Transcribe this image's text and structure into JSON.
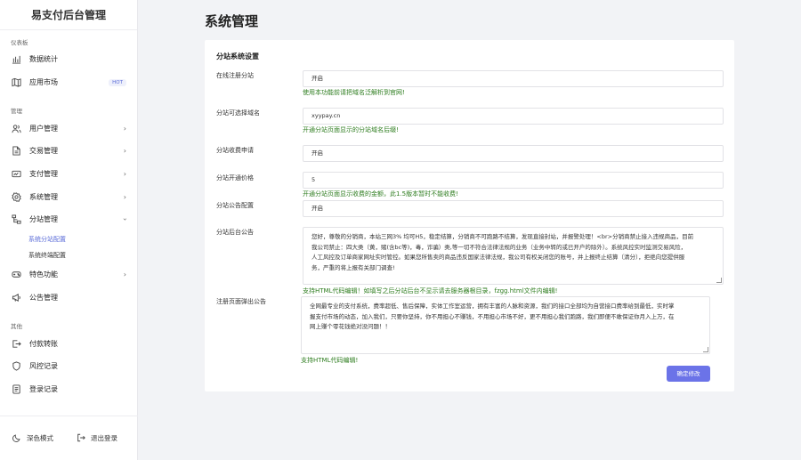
{
  "app": {
    "title": "易支付后台管理"
  },
  "sidebar": {
    "sections": {
      "dashboard": "仪表板",
      "manage": "管理",
      "other": "其他"
    },
    "items": {
      "stats": "数据统计",
      "market": "应用市场",
      "market_badge": "HOT",
      "users": "用户管理",
      "trade": "交易管理",
      "pay": "支付管理",
      "system": "系统管理",
      "site": "分站管理",
      "site_sub1": "系统分站配置",
      "site_sub2": "系统终端配置",
      "feature": "特色功能",
      "notice": "公告管理",
      "transfer": "付款转账",
      "risk": "风控记录",
      "login": "登录记录"
    },
    "footer": {
      "dark": "深色模式",
      "logout": "退出登录"
    }
  },
  "page": {
    "title": "系统管理"
  },
  "form": {
    "title": "分站系统设置",
    "fields": {
      "online_register": {
        "label": "在线注册分站",
        "value": "开启",
        "hint": "使用本功能前请把域名泛解析到官网!"
      },
      "domain": {
        "label": "分站可选择域名",
        "value": "xyypay.cn",
        "hint": "开通分站页面显示的分站域名后缀!"
      },
      "fee_apply": {
        "label": "分站收费申请",
        "value": "开启"
      },
      "price": {
        "label": "分站开通价格",
        "value": "5",
        "hint": "开通分站页面显示收费的金额，此1.5版本暂时不能收费!"
      },
      "notice_config": {
        "label": "分站公告配置",
        "value": "开启"
      },
      "backend_notice": {
        "label": "分站后台公告",
        "lines": [
          "您好，尊敬的分销商，本站三网3% 均可H5，稳定结算，分销商不可跑路不结算，发现直接封站，并报警处理！<br>分销商禁止接入违规商品，目前",
          "我公司禁止：四大类（黄，赌(含bc等)，毒，诈骗）类,等一切不符合法律法规的业务（业务中转的或已开户的除外）。系统风控实时监测交易风险，",
          "人工风控及订单商家网址实时管控。如果您所售卖的商品违反国家法律法规，我公司有权关闭您的账号，并上报终止结算（清分），拒绝向您提供服",
          "务，严重的将上报有关部门调查!"
        ],
        "hint": "支持HTML代码编辑！如填写之后分站后台不显示请去服务器根目录，fzgg.html文件内编辑!"
      },
      "popup_notice": {
        "label": "注册页面弹出公告",
        "lines": [
          "全网最专业的支付系统，费率超低、售后保障，实体工作室运营，拥有丰富的人脉和资源，我们的接口全部均为自营接口费率给到最低，实时掌",
          "握支付市场的动态，加入我们，只要你坚持，你不用担心不赚钱，不用担心市场不好，更不用担心我们跑路，我们即便不敢保证你月入上万，在",
          "网上赚个零花钱绝对没问题！！"
        ],
        "hint": "支持HTML代码编辑!"
      }
    },
    "submit": "确定修改"
  }
}
